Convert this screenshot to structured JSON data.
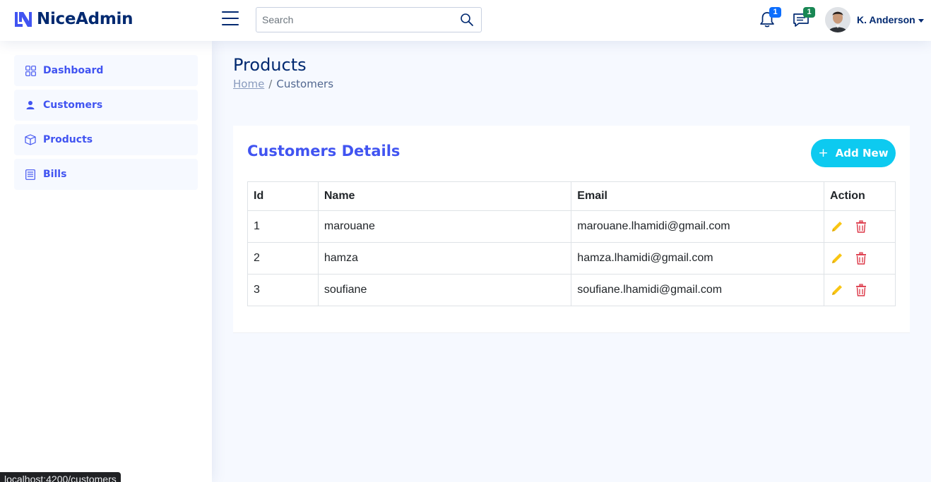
{
  "brand": {
    "name": "NiceAdmin",
    "accent": "#4154f1",
    "dark": "#012970"
  },
  "search": {
    "placeholder": "Search",
    "value": ""
  },
  "header": {
    "notifications_count": "1",
    "messages_count": "1",
    "profile_name": "K. Anderson"
  },
  "sidebar": {
    "items": [
      {
        "label": "Dashboard",
        "icon": "grid-icon"
      },
      {
        "label": "Customers",
        "icon": "person-icon"
      },
      {
        "label": "Products",
        "icon": "box-icon"
      },
      {
        "label": "Bills",
        "icon": "receipt-icon"
      }
    ]
  },
  "main": {
    "page_title": "Products",
    "breadcrumb": {
      "home": "Home",
      "separator": "/",
      "current": "Customers"
    },
    "card": {
      "title_light": "Customers ",
      "title_bold": "Details",
      "add_button": {
        "icon": "+",
        "label": "Add New"
      },
      "table": {
        "headers": [
          "Id",
          "Name",
          "Email",
          "Action"
        ],
        "rows": [
          {
            "id": "1",
            "name": "marouane",
            "email": "marouane.lhamidi@gmail.com"
          },
          {
            "id": "2",
            "name": "hamza",
            "email": "hamza.lhamidi@gmail.com"
          },
          {
            "id": "3",
            "name": "soufiane",
            "email": "soufiane.lhamidi@gmail.com"
          }
        ]
      }
    }
  },
  "status_bar": {
    "url": "localhost:4200/customers"
  },
  "colors": {
    "edit": "#f9c513",
    "delete": "#dc3545",
    "add_button": "#0dcaf0"
  }
}
